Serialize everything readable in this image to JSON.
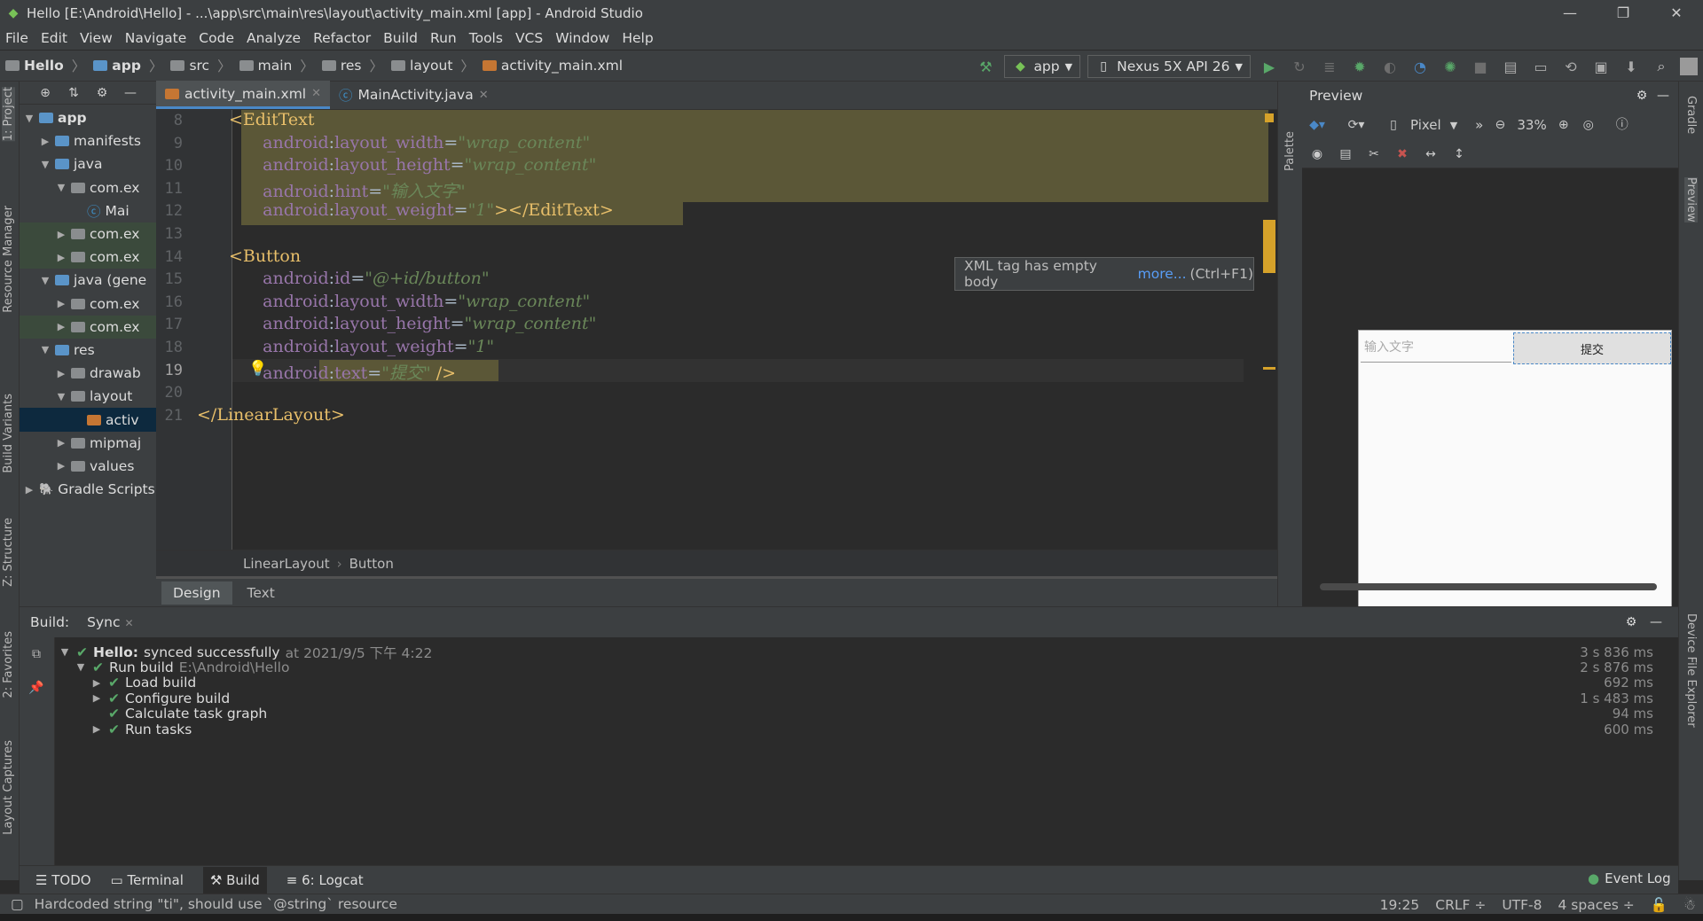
{
  "window": {
    "title": "Hello [E:\\Android\\Hello] - ...\\app\\src\\main\\res\\layout\\activity_main.xml [app] - Android Studio",
    "minimize": "—",
    "restore": "❐",
    "close": "✕"
  },
  "menu": [
    "File",
    "Edit",
    "View",
    "Navigate",
    "Code",
    "Analyze",
    "Refactor",
    "Build",
    "Run",
    "Tools",
    "VCS",
    "Window",
    "Help"
  ],
  "breadcrumb": [
    "Hello",
    "app",
    "src",
    "main",
    "res",
    "layout",
    "activity_main.xml"
  ],
  "toolbar": {
    "run_config": "app",
    "device": "Nexus 5X API 26"
  },
  "project_panel": {
    "tree": [
      {
        "label": "app",
        "depth": 0,
        "expanded": true,
        "icon": "module-folder"
      },
      {
        "label": "manifests",
        "depth": 1,
        "expanded": false,
        "icon": "folder-blue"
      },
      {
        "label": "java",
        "depth": 1,
        "expanded": true,
        "icon": "folder-blue"
      },
      {
        "label": "com.ex",
        "depth": 2,
        "expanded": true,
        "icon": "package"
      },
      {
        "label": "Mai",
        "depth": 3,
        "expanded": null,
        "icon": "class"
      },
      {
        "label": "com.ex",
        "depth": 2,
        "expanded": false,
        "icon": "package"
      },
      {
        "label": "com.ex",
        "depth": 2,
        "expanded": false,
        "icon": "package"
      },
      {
        "label": "java (gene",
        "depth": 1,
        "expanded": true,
        "icon": "folder-gen"
      },
      {
        "label": "com.ex",
        "depth": 2,
        "expanded": false,
        "icon": "package"
      },
      {
        "label": "com.ex",
        "depth": 2,
        "expanded": false,
        "icon": "package"
      },
      {
        "label": "res",
        "depth": 1,
        "expanded": true,
        "icon": "folder-res"
      },
      {
        "label": "drawab",
        "depth": 2,
        "expanded": false,
        "icon": "folder"
      },
      {
        "label": "layout",
        "depth": 2,
        "expanded": true,
        "icon": "folder"
      },
      {
        "label": "activ",
        "depth": 3,
        "expanded": null,
        "icon": "xml"
      },
      {
        "label": "mipmaj",
        "depth": 2,
        "expanded": false,
        "icon": "folder"
      },
      {
        "label": "values",
        "depth": 2,
        "expanded": false,
        "icon": "folder"
      },
      {
        "label": "Gradle Scripts",
        "depth": 0,
        "expanded": false,
        "icon": "gradle"
      }
    ]
  },
  "left_strip": [
    "1: Project",
    "Resource Manager",
    "Build Variants",
    "Z: Structure",
    "2: Favorites",
    "Layout Captures"
  ],
  "right_strip": [
    "Gradle",
    "Preview",
    "Device File Explorer"
  ],
  "editor": {
    "tabs": [
      {
        "label": "activity_main.xml",
        "active": true
      },
      {
        "label": "MainActivity.java",
        "active": false
      }
    ],
    "lines": [
      {
        "n": "8",
        "parts": [
          [
            "tag",
            "<EditText"
          ]
        ]
      },
      {
        "n": "9",
        "parts": [
          [
            "ns",
            "    android"
          ],
          [
            "plain",
            ":"
          ],
          [
            "attn",
            "layout_width"
          ],
          [
            "plain",
            "="
          ],
          [
            "val",
            "\"wrap_content\""
          ]
        ]
      },
      {
        "n": "10",
        "parts": [
          [
            "ns",
            "    android"
          ],
          [
            "plain",
            ":"
          ],
          [
            "attn",
            "layout_height"
          ],
          [
            "plain",
            "="
          ],
          [
            "val",
            "\"wrap_content\""
          ]
        ]
      },
      {
        "n": "11",
        "parts": [
          [
            "ns",
            "    android"
          ],
          [
            "plain",
            ":"
          ],
          [
            "attn",
            "hint"
          ],
          [
            "plain",
            "="
          ],
          [
            "val",
            "\"输入文字\""
          ]
        ]
      },
      {
        "n": "12",
        "parts": [
          [
            "ns",
            "    android"
          ],
          [
            "plain",
            ":"
          ],
          [
            "attn",
            "layout_weight"
          ],
          [
            "plain",
            "="
          ],
          [
            "val",
            "\"1\""
          ],
          [
            "tag",
            "></EditText>"
          ]
        ]
      },
      {
        "n": "13",
        "parts": []
      },
      {
        "n": "14",
        "parts": [
          [
            "tag",
            "<Button"
          ]
        ]
      },
      {
        "n": "15",
        "parts": [
          [
            "ns",
            "    android"
          ],
          [
            "plain",
            ":"
          ],
          [
            "attn",
            "id"
          ],
          [
            "plain",
            "="
          ],
          [
            "val",
            "\"@+id/button\""
          ]
        ]
      },
      {
        "n": "16",
        "parts": [
          [
            "ns",
            "    android"
          ],
          [
            "plain",
            ":"
          ],
          [
            "attn",
            "layout_width"
          ],
          [
            "plain",
            "="
          ],
          [
            "val",
            "\"wrap_content\""
          ]
        ]
      },
      {
        "n": "17",
        "parts": [
          [
            "ns",
            "    android"
          ],
          [
            "plain",
            ":"
          ],
          [
            "attn",
            "layout_height"
          ],
          [
            "plain",
            "="
          ],
          [
            "val",
            "\"wrap_content\""
          ]
        ]
      },
      {
        "n": "18",
        "parts": [
          [
            "ns",
            "    android"
          ],
          [
            "plain",
            ":"
          ],
          [
            "attn",
            "layout_weight"
          ],
          [
            "plain",
            "="
          ],
          [
            "val",
            "\"1\""
          ]
        ]
      },
      {
        "n": "19",
        "parts": [
          [
            "ns",
            "    android"
          ],
          [
            "plain",
            ":"
          ],
          [
            "attn",
            "text"
          ],
          [
            "plain",
            "="
          ],
          [
            "val",
            "\"提交\""
          ],
          [
            "tag",
            " />"
          ]
        ]
      },
      {
        "n": "20",
        "parts": []
      },
      {
        "n": "21",
        "parts": [
          [
            "tag",
            "</LinearLayout>"
          ]
        ]
      }
    ],
    "tooltip": {
      "text": "XML tag has empty body",
      "link": "more...",
      "shortcut": "(Ctrl+F1)"
    },
    "structure_breadcrumb": [
      "LinearLayout",
      "Button"
    ],
    "mode_tabs": [
      {
        "label": "Design",
        "active": true
      },
      {
        "label": "Text",
        "active": false
      }
    ]
  },
  "preview": {
    "title": "Preview",
    "palette_label": "Palette",
    "device": "Pixel",
    "zoom": "33%",
    "hint_text": "输入文字",
    "button_text": "提交"
  },
  "build": {
    "tabs": [
      "Build:",
      "Sync"
    ],
    "rows": [
      {
        "depth": 0,
        "expanded": true,
        "bold": "Hello:",
        "text": "synced successfully",
        "dim": "at 2021/9/5 下午 4:22",
        "time": "3 s 836 ms"
      },
      {
        "depth": 1,
        "expanded": true,
        "bold": "",
        "text": "Run build",
        "dim": "E:\\Android\\Hello",
        "time": "2 s 876 ms"
      },
      {
        "depth": 2,
        "expanded": false,
        "bold": "",
        "text": "Load build",
        "dim": "",
        "time": "692 ms"
      },
      {
        "depth": 2,
        "expanded": false,
        "bold": "",
        "text": "Configure build",
        "dim": "",
        "time": "1 s 483 ms"
      },
      {
        "depth": 2,
        "expanded": null,
        "bold": "",
        "text": "Calculate task graph",
        "dim": "",
        "time": "94 ms"
      },
      {
        "depth": 2,
        "expanded": false,
        "bold": "",
        "text": "Run tasks",
        "dim": "",
        "time": "600 ms"
      }
    ]
  },
  "bottom_tabs": [
    {
      "label": "TODO",
      "icon": "list-icon",
      "active": false
    },
    {
      "label": "Terminal",
      "icon": "terminal-icon",
      "active": false
    },
    {
      "label": "Build",
      "icon": "hammer-icon",
      "active": true
    },
    {
      "label": "6: Logcat",
      "icon": "logcat-icon",
      "active": false
    }
  ],
  "event_log": "Event Log",
  "status": {
    "message": "Hardcoded string \"ti\", should use `@string` resource",
    "position": "19:25",
    "line_sep": "CRLF",
    "encoding": "UTF-8",
    "indent": "4 spaces"
  },
  "colors": {
    "accent": "#4a88c7",
    "success": "#59a869",
    "run": "#59a869",
    "highlight": "#5b5737"
  }
}
